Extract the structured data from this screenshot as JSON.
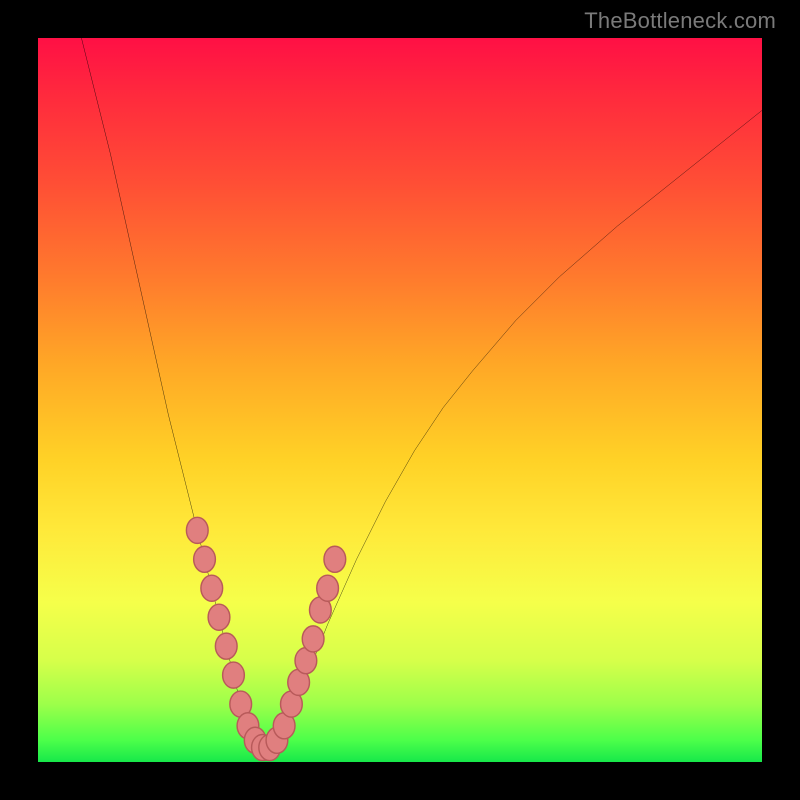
{
  "watermark": "TheBottleneck.com",
  "colors": {
    "page_bg": "#000000",
    "watermark": "#7a7a7a",
    "curve_stroke": "#000000",
    "dot_fill": "#e07f7f",
    "dot_stroke": "#b85a5a",
    "gradient_stops": [
      "#ff1045",
      "#ff2a3d",
      "#ff4e35",
      "#ff7a2d",
      "#ffa726",
      "#ffd126",
      "#ffe93a",
      "#f5ff4a",
      "#d6ff4a",
      "#9dff4a",
      "#4cff4a",
      "#17e84a"
    ]
  },
  "chart_data": {
    "type": "line",
    "title": "",
    "xlabel": "",
    "ylabel": "",
    "xlim": [
      0,
      100
    ],
    "ylim": [
      0,
      100
    ],
    "grid": false,
    "legend": false,
    "series": [
      {
        "name": "bottleneck-curve",
        "x": [
          6,
          8,
          10,
          12,
          14,
          16,
          18,
          20,
          22,
          24,
          26,
          27,
          28,
          29,
          30,
          31,
          32,
          33,
          34,
          36,
          38,
          40,
          44,
          48,
          52,
          56,
          60,
          66,
          72,
          80,
          90,
          100
        ],
        "y": [
          100,
          92,
          84,
          75,
          66,
          57,
          48,
          40,
          32,
          24,
          16,
          12,
          8,
          5,
          2,
          1,
          1,
          2,
          4,
          9,
          14,
          19,
          28,
          36,
          43,
          49,
          54,
          61,
          67,
          74,
          82,
          90
        ]
      }
    ],
    "markers": [
      {
        "name": "highlight-dots",
        "points": [
          [
            22,
            32
          ],
          [
            23,
            28
          ],
          [
            24,
            24
          ],
          [
            25,
            20
          ],
          [
            26,
            16
          ],
          [
            27,
            12
          ],
          [
            28,
            8
          ],
          [
            29,
            5
          ],
          [
            30,
            3
          ],
          [
            31,
            2
          ],
          [
            32,
            2
          ],
          [
            33,
            3
          ],
          [
            34,
            5
          ],
          [
            35,
            8
          ],
          [
            36,
            11
          ],
          [
            37,
            14
          ],
          [
            38,
            17
          ],
          [
            39,
            21
          ],
          [
            40,
            24
          ],
          [
            41,
            28
          ]
        ]
      }
    ]
  }
}
